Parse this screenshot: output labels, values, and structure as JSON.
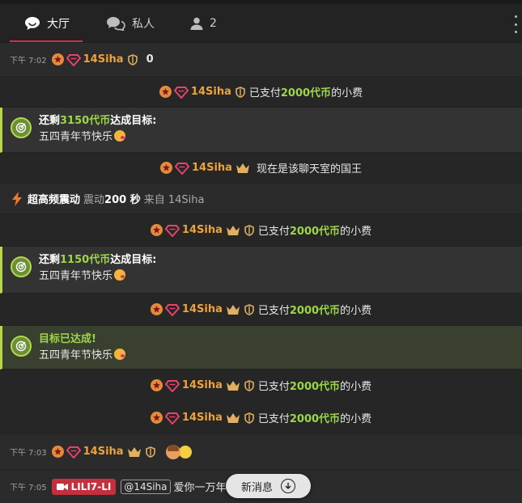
{
  "tabs": {
    "lobby": "大厅",
    "private": "私人",
    "users_count": "2"
  },
  "messages": {
    "m1": {
      "time": "下午 7:02",
      "user": "14Siha",
      "count": "0"
    },
    "m2": {
      "user": "14Siha",
      "text_a": "已支付",
      "amount": "2000代币",
      "text_b": "的小费"
    },
    "m3": {
      "prefix": "还剩",
      "amount": "3150代币",
      "suffix": "达成目标:",
      "goal": "五四青年节快乐"
    },
    "m4": {
      "user": "14Siha",
      "text": "现在是该聊天室的国王"
    },
    "m5": {
      "title": "超高频震动",
      "label": "震动",
      "duration": "200 秒",
      "from": "来自 14Siha"
    },
    "m6": {
      "user": "14Siha",
      "text_a": "已支付",
      "amount": "2000代币",
      "text_b": "的小费"
    },
    "m7": {
      "prefix": "还剩",
      "amount": "1150代币",
      "suffix": "达成目标:",
      "goal": "五四青年节快乐"
    },
    "m8": {
      "user": "14Siha",
      "text_a": "已支付",
      "amount": "2000代币",
      "text_b": "的小费"
    },
    "m9": {
      "title": "目标已达成!",
      "goal": "五四青年节快乐"
    },
    "m10": {
      "user": "14Siha",
      "text_a": "已支付",
      "amount": "2000代币",
      "text_b": "的小费"
    },
    "m11": {
      "user": "14Siha",
      "text_a": "已支付",
      "amount": "2000代币",
      "text_b": "的小费"
    },
    "m12": {
      "time": "下午 7:03",
      "user": "14Siha"
    },
    "m13": {
      "time": "下午 7:05",
      "tag": "LILI7-LI",
      "mention": "@14Siha",
      "text": "爱你一万年"
    }
  },
  "new_messages_label": "新消息",
  "colors": {
    "accent": "#d4304a",
    "username": "#f0a23a",
    "tokens": "#9bd64a",
    "goal_border": "#b6d64b"
  }
}
